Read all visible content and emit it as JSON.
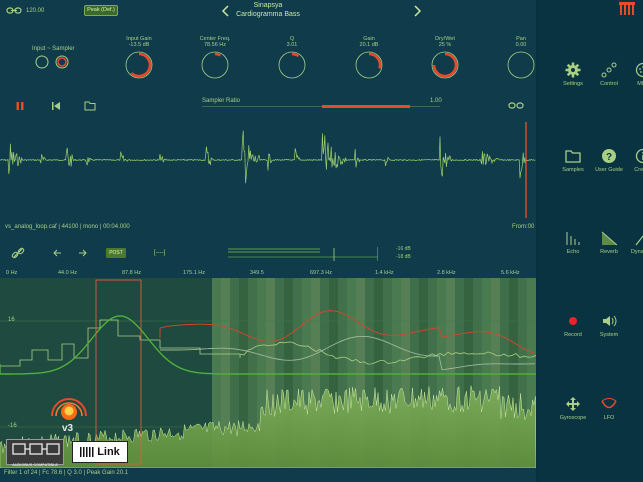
{
  "top": {
    "buffer_label": "120.00",
    "peak_button": "Peak (Def.)",
    "title": "Sinapsya",
    "subtitle": "Cardiogramma Bass"
  },
  "input": {
    "label": "Input ~ Sampler"
  },
  "knobs": [
    {
      "name": "Input Gain",
      "value": "-13.5 dB",
      "level": 0.62,
      "color": "#e84a2a"
    },
    {
      "name": "Center Freq.",
      "value": "78.56 Hz",
      "level": 0.08,
      "color": "#e84a2a"
    },
    {
      "name": "Q",
      "value": "3.01",
      "level": 0.1,
      "color": "#e84a2a"
    },
    {
      "name": "Gain",
      "value": "20.1 dB",
      "level": 0.3,
      "color": "#e84a2a"
    },
    {
      "name": "Dry/Wet",
      "value": "25 %",
      "level": 0.75,
      "color": "#e84a2a"
    },
    {
      "name": "Pan",
      "value": "0.00",
      "level": 0.0,
      "color": "#e84a2a"
    }
  ],
  "transport": {
    "sampler_ratio_label": "Sampler Ratio",
    "ratio_value": "1.00",
    "ratio_level": 0.7
  },
  "sample": {
    "info": "vs_analog_loop.caf | 44100 | mono | 00:04.000",
    "from_label": "From:00"
  },
  "analyzer": {
    "post_label": "POST",
    "bracket_label": "[----]",
    "meter_top": "-16 dB",
    "meter_bottom": "-18 dB",
    "freq_labels": [
      "0 Hz",
      "44.0 Hz",
      "87.8 Hz",
      "175.1 Hz",
      "349.5",
      "697.3 Hz",
      "1.4 kHz",
      "2.8 kHz",
      "5.6 kHz"
    ],
    "y_top": "16",
    "y_bottom": "-16",
    "status": "Filter 1 of 24 | Fc 78.6 | Q 3.0 | Peak Gain 20.1"
  },
  "badges": {
    "v3": "v3",
    "audiobus": "AUDIOBUS COMPATIBLE",
    "link": "Link"
  },
  "sidebar": [
    {
      "label": "Settings",
      "icon": "gear-icon"
    },
    {
      "label": "Control",
      "icon": "link-chain-icon"
    },
    {
      "label": "MIDI",
      "icon": "midi-port-icon"
    },
    {
      "label": "Samples",
      "icon": "folder-icon"
    },
    {
      "label": "User Guide",
      "icon": "help-icon"
    },
    {
      "label": "Credits",
      "icon": "info-icon"
    },
    {
      "label": "Echo",
      "icon": "echo-icon"
    },
    {
      "label": "Reverb",
      "icon": "reverb-icon"
    },
    {
      "label": "Dynamics",
      "icon": "dynamics-icon"
    },
    {
      "label": "Record",
      "icon": "record-icon"
    },
    {
      "label": "System",
      "icon": "speaker-icon"
    },
    {
      "label": "Gyroscope",
      "icon": "gyroscope-icon"
    },
    {
      "label": "LFO",
      "icon": "lfo-icon"
    }
  ],
  "colors": {
    "accent": "#e84a2a",
    "green": "#9fd16a",
    "bg": "#0f3b4b"
  }
}
